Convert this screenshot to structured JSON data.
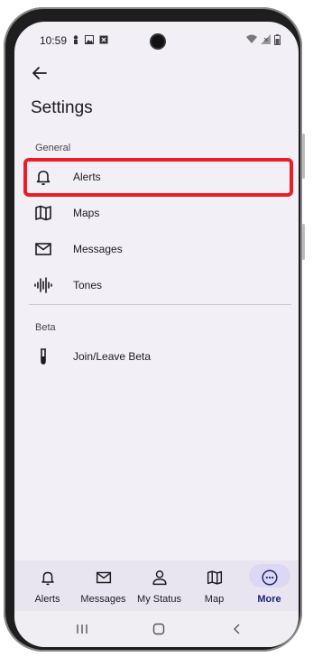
{
  "status_bar": {
    "time": "10:59"
  },
  "header": {
    "title": "Settings"
  },
  "sections": [
    {
      "label": "General",
      "items": [
        {
          "label": "Alerts",
          "icon": "bell-icon"
        },
        {
          "label": "Maps",
          "icon": "map-icon"
        },
        {
          "label": "Messages",
          "icon": "mail-icon"
        },
        {
          "label": "Tones",
          "icon": "sound-wave-icon"
        }
      ]
    },
    {
      "label": "Beta",
      "items": [
        {
          "label": "Join/Leave Beta",
          "icon": "test-tube-icon"
        }
      ]
    }
  ],
  "bottom_nav": [
    {
      "label": "Alerts",
      "icon": "bell-icon"
    },
    {
      "label": "Messages",
      "icon": "mail-icon"
    },
    {
      "label": "My Status",
      "icon": "person-icon"
    },
    {
      "label": "Map",
      "icon": "map-icon"
    },
    {
      "label": "More",
      "icon": "more-icon",
      "active": true
    }
  ],
  "colors": {
    "highlight": "#ee1d25",
    "background": "#f2eff7",
    "nav_active": "#1a237e"
  }
}
